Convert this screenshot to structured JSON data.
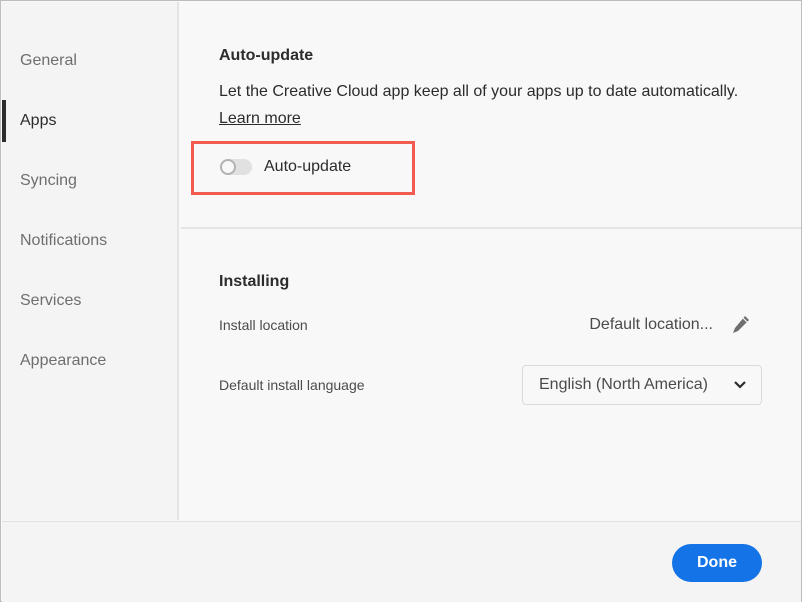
{
  "sidebar": {
    "items": [
      {
        "label": "General"
      },
      {
        "label": "Apps",
        "active": true
      },
      {
        "label": "Syncing"
      },
      {
        "label": "Notifications"
      },
      {
        "label": "Services"
      },
      {
        "label": "Appearance"
      }
    ]
  },
  "autoupdate": {
    "title": "Auto-update",
    "description": "Let the Creative Cloud app keep all of your apps up to date automatically.",
    "learn_more": "Learn more",
    "toggle_label": "Auto-update",
    "toggle_on": false,
    "highlight_color": "#f25b50"
  },
  "installing": {
    "title": "Installing",
    "install_location_label": "Install location",
    "install_location_value": "Default location...",
    "language_label": "Default install language",
    "language_value": "English (North America)"
  },
  "footer": {
    "done_label": "Done",
    "accent": "#1473e6"
  }
}
